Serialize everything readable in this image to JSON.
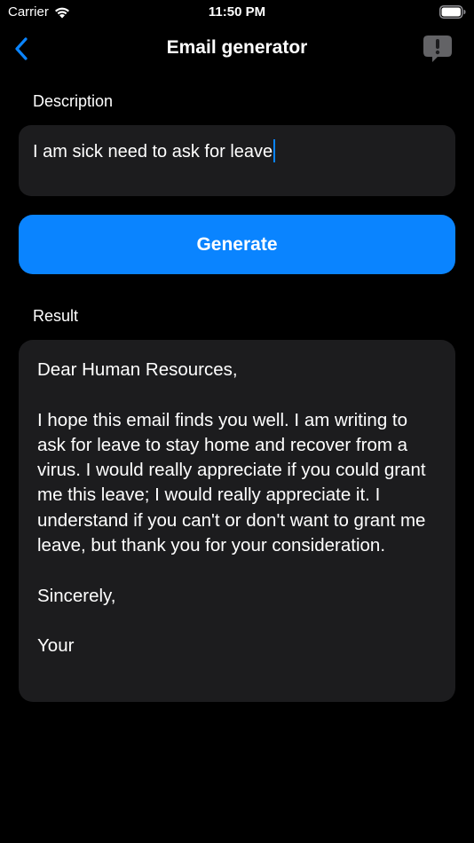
{
  "status_bar": {
    "carrier": "Carrier",
    "time": "11:50 PM",
    "wifi_icon": "wifi-icon",
    "battery_icon": "battery-icon"
  },
  "nav": {
    "title": "Email generator",
    "back_icon": "chevron-left-icon",
    "feedback_icon": "feedback-bubble-icon"
  },
  "description": {
    "label": "Description",
    "value": "I am sick need to ask for leave"
  },
  "generate": {
    "label": "Generate"
  },
  "result": {
    "label": "Result",
    "text": "Dear Human Resources,\n\nI hope this email finds you well. I am writing to ask for leave to stay home and recover from a virus. I would really appreciate if you could grant me this leave; I would really appreciate it. I understand if you can't or don't want to grant me leave, but thank you for your consideration.\n\nSincerely,\n\nYour"
  },
  "colors": {
    "accent": "#0a84ff",
    "background": "#000000",
    "card": "#1c1c1e"
  }
}
